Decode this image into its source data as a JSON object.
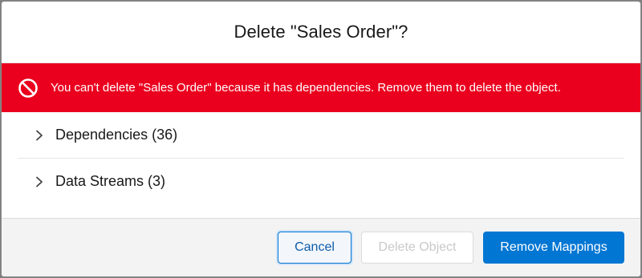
{
  "modal": {
    "title": "Delete \"Sales Order\"?"
  },
  "error": {
    "icon": "ban-icon",
    "message": "You can't delete \"Sales Order\" because it has dependencies. Remove them to delete the object.",
    "color": "#ea001e"
  },
  "sections": [
    {
      "icon": "chevron-right-icon",
      "label": "Dependencies (36)"
    },
    {
      "icon": "chevron-right-icon",
      "label": "Data Streams (3)"
    }
  ],
  "footer": {
    "cancel_label": "Cancel",
    "delete_label": "Delete Object",
    "remove_label": "Remove Mappings",
    "accent_color": "#0176d3"
  }
}
